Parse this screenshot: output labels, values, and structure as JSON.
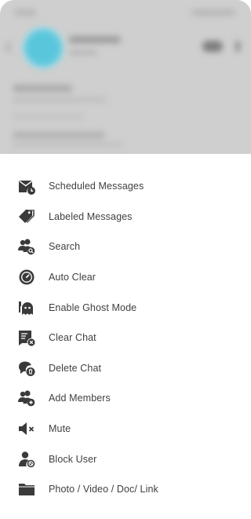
{
  "colors": {
    "sheet_background": "#ffffff",
    "backdrop": "#cfcfcf",
    "icon": "#3a3a3a",
    "label_text": "#3f3f3f",
    "avatar_accent": "#5ac6dc"
  },
  "menu": {
    "items": [
      {
        "label": "Scheduled Messages",
        "icon": "scheduled-messages-icon"
      },
      {
        "label": "Labeled Messages",
        "icon": "label-tag-icon"
      },
      {
        "label": "Search",
        "icon": "search-user-icon"
      },
      {
        "label": "Auto Clear",
        "icon": "auto-clear-timer-icon"
      },
      {
        "label": "Enable Ghost Mode",
        "icon": "ghost-icon"
      },
      {
        "label": "Clear Chat",
        "icon": "clear-chat-icon"
      },
      {
        "label": "Delete Chat",
        "icon": "delete-chat-icon"
      },
      {
        "label": "Add Members",
        "icon": "add-members-icon"
      },
      {
        "label": "Mute",
        "icon": "mute-speaker-icon"
      },
      {
        "label": "Block User",
        "icon": "block-user-icon"
      },
      {
        "label": "Photo / Video / Doc/ Link",
        "icon": "folder-icon"
      }
    ]
  }
}
